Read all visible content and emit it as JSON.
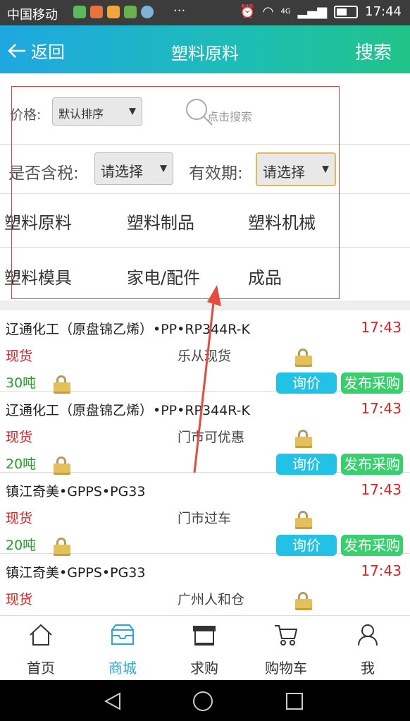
{
  "status": {
    "carrier": "中国移动",
    "more": "···",
    "net": "4G",
    "time": "17:44"
  },
  "header": {
    "back": "返回",
    "title": "塑料原料",
    "search": "搜索"
  },
  "filter": {
    "price_label": "价格:",
    "price_value": "默认排序",
    "search_placeholder": "点击搜索",
    "tax_label": "是否含税:",
    "tax_value": "请选择",
    "valid_label": "有效期:",
    "valid_value": "请选择"
  },
  "categories": [
    "塑料原料",
    "塑料制品",
    "塑料机械",
    "塑料模具",
    "家电/配件",
    "成品"
  ],
  "items": [
    {
      "name": "辽通化工（原盘锦乙烯）•PP•RP344R-K",
      "time": "17:43",
      "kind": "现货",
      "loc": "乐从现货",
      "qty": "30吨",
      "ask": "询价",
      "pub": "发布采购"
    },
    {
      "name": "辽通化工（原盘锦乙烯）•PP•RP344R-K",
      "time": "17:43",
      "kind": "现货",
      "loc": "门市可优惠",
      "qty": "20吨",
      "ask": "询价",
      "pub": "发布采购"
    },
    {
      "name": "镇江奇美•GPPS•PG33",
      "time": "17:43",
      "kind": "现货",
      "loc": "门市过车",
      "qty": "20吨",
      "ask": "询价",
      "pub": "发布采购"
    },
    {
      "name": "镇江奇美•GPPS•PG33",
      "time": "17:43",
      "kind": "现货",
      "loc": "广州人和仓",
      "qty": "",
      "ask": "",
      "pub": ""
    }
  ],
  "tabs": [
    {
      "label": "首页",
      "icon": "home-icon"
    },
    {
      "label": "商城",
      "icon": "mall-icon",
      "active": true
    },
    {
      "label": "求购",
      "icon": "shop-icon"
    },
    {
      "label": "购物车",
      "icon": "cart-icon"
    },
    {
      "label": "我",
      "icon": "user-icon"
    }
  ],
  "colors": {
    "accent": "#29a7dc",
    "ask": "#22c1e6",
    "publish": "#38d06c",
    "price_red": "#e02020",
    "qty_green": "#23a02a"
  }
}
